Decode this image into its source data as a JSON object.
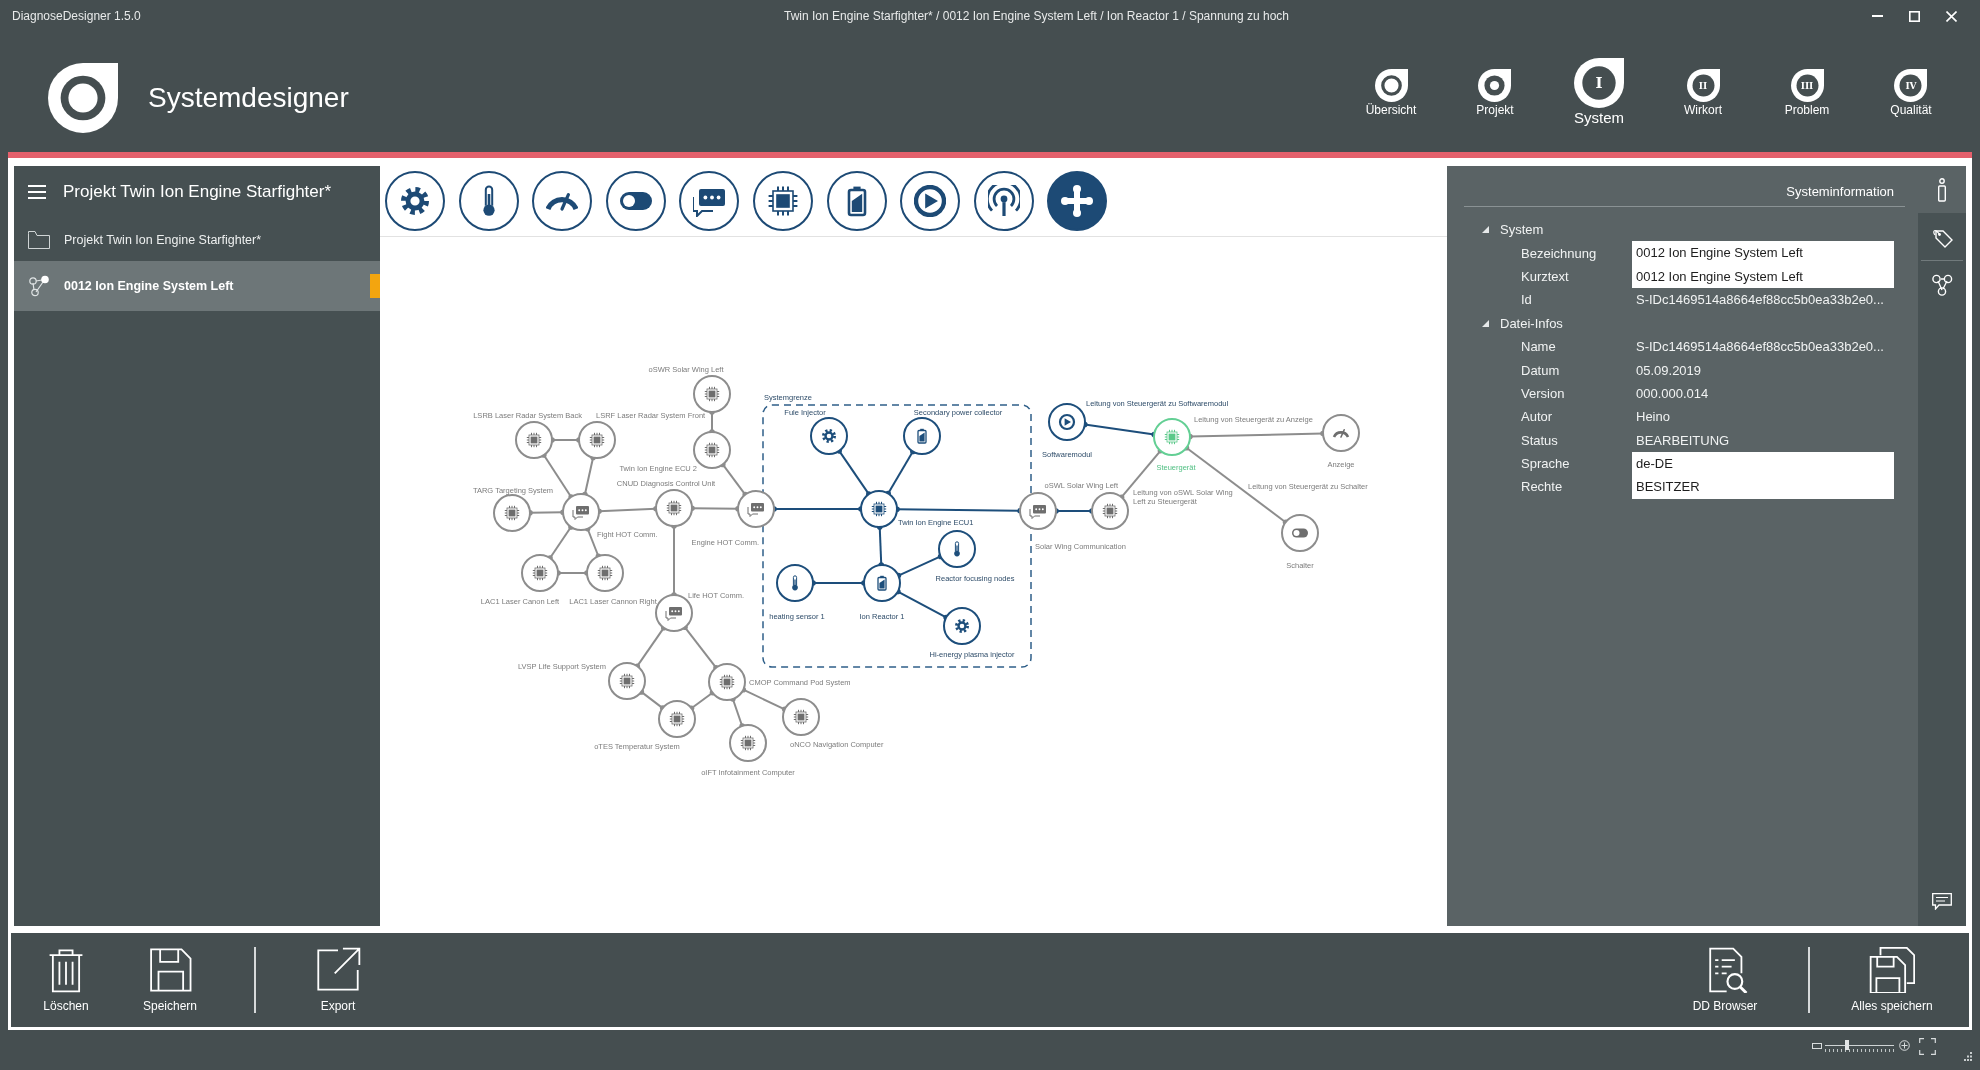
{
  "window": {
    "app_name": "DiagnoseDesigner 1.5.0",
    "title": "Twin Ion Engine Starfighter* / 0012 Ion Engine System Left / Ion Reactor 1 / Spannung zu hoch"
  },
  "header": {
    "title": "Systemdesigner",
    "nav": [
      {
        "label": "Übersicht",
        "kind": "ring",
        "selected": false
      },
      {
        "label": "Projekt",
        "kind": "dot",
        "selected": false
      },
      {
        "label": "System",
        "kind": "numeral",
        "numeral": "I",
        "selected": true
      },
      {
        "label": "Wirkort",
        "kind": "numeral",
        "numeral": "II",
        "selected": false
      },
      {
        "label": "Problem",
        "kind": "numeral",
        "numeral": "III",
        "selected": false
      },
      {
        "label": "Qualität",
        "kind": "numeral",
        "numeral": "IV",
        "selected": false
      }
    ]
  },
  "sidebar": {
    "title": "Projekt Twin Ion Engine Starfighter*",
    "items": [
      {
        "label": "Projekt Twin Ion Engine Starfighter*",
        "kind": "project",
        "selected": false
      },
      {
        "label": "0012 Ion Engine System Left",
        "kind": "system",
        "selected": true
      }
    ]
  },
  "palette": [
    {
      "kind": "gear",
      "selected": false
    },
    {
      "kind": "thermometer",
      "selected": false
    },
    {
      "kind": "gauge",
      "selected": false
    },
    {
      "kind": "toggle",
      "selected": false
    },
    {
      "kind": "comm",
      "selected": false
    },
    {
      "kind": "chip",
      "selected": false
    },
    {
      "kind": "battery",
      "selected": false
    },
    {
      "kind": "play",
      "selected": false
    },
    {
      "kind": "antenna",
      "selected": false
    },
    {
      "kind": "cross",
      "selected": true
    }
  ],
  "diagram": {
    "boundary_label": "Systemgrenze",
    "nodes": [
      {
        "label": "oSWR Solar Wing Left",
        "kind": "chip",
        "active": false,
        "selected": false
      },
      {
        "label": "LSRB Laser Radar System Back",
        "kind": "chip",
        "active": false,
        "selected": false
      },
      {
        "label": "LSRF Laser Radar System Front",
        "kind": "chip",
        "active": false,
        "selected": false
      },
      {
        "label": "Twin Ion Engine ECU 2",
        "kind": "chip",
        "active": false,
        "selected": false
      },
      {
        "label": "Fule Injector",
        "kind": "gear",
        "active": true,
        "selected": false
      },
      {
        "label": "Secondary power collector",
        "kind": "battery",
        "active": true,
        "selected": false
      },
      {
        "label": "Softwaremodul",
        "kind": "play",
        "active": true,
        "selected": false
      },
      {
        "label": "Steuergerät",
        "kind": "chip",
        "active": false,
        "selected": true
      },
      {
        "label": "Anzeige",
        "kind": "gauge",
        "active": false,
        "selected": false
      },
      {
        "label": "TARG Targeting System",
        "kind": "chip",
        "active": false,
        "selected": false
      },
      {
        "label": "CNUD Diagnosis Control Unit",
        "kind": "chip",
        "active": false,
        "selected": false
      },
      {
        "label": "Fight HOT Comm.",
        "kind": "comm",
        "active": false,
        "selected": false
      },
      {
        "label": "Engine HOT Comm.",
        "kind": "comm",
        "active": false,
        "selected": false
      },
      {
        "label": "Twin Ion Engine ECU1",
        "kind": "chip",
        "active": true,
        "selected": false
      },
      {
        "label": "oSWL Solar Wing Left",
        "kind": "chip",
        "active": false,
        "selected": false
      },
      {
        "label": "Solar Wing Communication",
        "kind": "comm",
        "active": false,
        "selected": false
      },
      {
        "label": "Schalter",
        "kind": "toggle",
        "active": false,
        "selected": false
      },
      {
        "label": "LAC1 Laser Canon Left",
        "kind": "chip",
        "active": false,
        "selected": false
      },
      {
        "label": "LAC1 Laser Cannon Right",
        "kind": "chip",
        "active": false,
        "selected": false
      },
      {
        "label": "heating sensor 1",
        "kind": "thermometer",
        "active": true,
        "selected": false
      },
      {
        "label": "Ion Reactor 1",
        "kind": "battery",
        "active": true,
        "selected": false
      },
      {
        "label": "Reactor focusing nodes",
        "kind": "thermometer",
        "active": true,
        "selected": false
      },
      {
        "label": "Life HOT Comm.",
        "kind": "comm",
        "active": false,
        "selected": false
      },
      {
        "label": "Hi-energy plasma injector",
        "kind": "gear",
        "active": true,
        "selected": false
      },
      {
        "label": "LVSP Life Support System",
        "kind": "chip",
        "active": false,
        "selected": false
      },
      {
        "label": "CMOP Command Pod System",
        "kind": "chip",
        "active": false,
        "selected": false
      },
      {
        "label": "oTES Temperatur System",
        "kind": "chip",
        "active": false,
        "selected": false
      },
      {
        "label": "oNCO Navigation Computer",
        "kind": "chip",
        "active": false,
        "selected": false
      },
      {
        "label": "oIFT Infotainment Computer",
        "kind": "chip",
        "active": false,
        "selected": false
      }
    ],
    "connections": [
      {
        "active": false
      },
      {
        "active": true,
        "label": "Leitung von Steuergerät zu Softwaremodul"
      },
      {
        "active": false,
        "label": "Leitung von Steuergerät zu Anzeige"
      },
      {
        "active": false
      },
      {
        "active": true
      },
      {
        "active": true
      },
      {
        "active": false,
        "label": "Leitung von Steuergerät zu Schalter"
      },
      {
        "active": false,
        "label": "Leitung von oSWL Solar Wing Left zu Steuergerät"
      },
      {
        "active": false
      },
      {
        "active": false
      },
      {
        "active": false
      },
      {
        "active": false
      },
      {
        "active": true
      },
      {
        "active": false
      },
      {
        "active": true
      },
      {
        "active": true
      },
      {
        "active": false
      },
      {
        "active": false
      },
      {
        "active": false
      },
      {
        "active": true
      },
      {
        "active": false
      },
      {
        "active": true
      },
      {
        "active": false
      },
      {
        "active": true
      },
      {
        "active": true
      },
      {
        "active": false
      },
      {
        "active": false
      },
      {
        "active": false
      },
      {
        "active": false
      },
      {
        "active": false
      },
      {
        "active": false
      }
    ]
  },
  "properties": {
    "title": "Systeminformation",
    "groups": [
      {
        "label": "System",
        "expanded": true,
        "rows": [
          {
            "label": "Bezeichnung",
            "value": "0012 Ion Engine System Left",
            "editable": true
          },
          {
            "label": "Kurztext",
            "value": "0012 Ion Engine System Left",
            "editable": true
          },
          {
            "label": "Id",
            "value": "S-IDc1469514a8664ef88cc5b0ea33b2e0...",
            "editable": false
          }
        ]
      },
      {
        "label": "Datei-Infos",
        "expanded": true,
        "rows": [
          {
            "label": "Name",
            "value": "S-IDc1469514a8664ef88cc5b0ea33b2e0...",
            "editable": false
          },
          {
            "label": "Datum",
            "value": "05.09.2019",
            "editable": false
          },
          {
            "label": "Version",
            "value": "000.000.014",
            "editable": false
          },
          {
            "label": "Autor",
            "value": "Heino",
            "editable": false
          },
          {
            "label": "Status",
            "value": "BEARBEITUNG",
            "editable": false
          },
          {
            "label": "Sprache",
            "value": "de-DE",
            "editable": true
          },
          {
            "label": "Rechte",
            "value": "BESITZER",
            "editable": true
          }
        ]
      }
    ]
  },
  "side_tabs": [
    {
      "kind": "info",
      "selected": true
    },
    {
      "kind": "tag",
      "selected": false
    },
    {
      "kind": "network",
      "selected": false
    }
  ],
  "toolbar": {
    "left_groups": [
      [
        {
          "label": "Löschen",
          "kind": "trash"
        },
        {
          "label": "Speichern",
          "kind": "save"
        }
      ],
      [
        {
          "label": "Export",
          "kind": "export"
        }
      ]
    ],
    "right_groups": [
      [
        {
          "label": "DD Browser",
          "kind": "browser"
        }
      ],
      [
        {
          "label": "Alles speichern",
          "kind": "save_all"
        }
      ]
    ]
  },
  "zoom": {
    "level": 0.32
  }
}
